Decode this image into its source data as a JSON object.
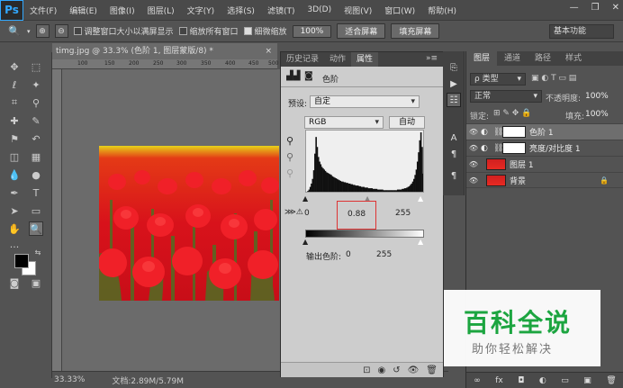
{
  "app": {
    "logo": "Ps"
  },
  "menu": [
    "文件(F)",
    "编辑(E)",
    "图像(I)",
    "图层(L)",
    "文字(Y)",
    "选择(S)",
    "滤镜(T)",
    "3D(D)",
    "视图(V)",
    "窗口(W)",
    "帮助(H)"
  ],
  "window_controls": {
    "minimize": "—",
    "restore": "❐",
    "close": "✕"
  },
  "options": {
    "cb1": "调整窗口大小以满屏显示",
    "cb2": "缩放所有窗口",
    "cb3": "细微缩放",
    "zoom": "100%",
    "fit_screen": "适合屏幕",
    "fill_screen": "填充屏幕",
    "workspace": "基本功能"
  },
  "document": {
    "tab": "timg.jpg @ 33.3% (色阶 1, 图层蒙版/8) *",
    "close": "×",
    "zoom": "33.33%",
    "doc_info": "文档:2.89M/5.79M",
    "ruler_ticks": [
      "100",
      "150",
      "200",
      "250",
      "300",
      "350",
      "400",
      "450",
      "500"
    ]
  },
  "properties": {
    "tabs": [
      "历史记录",
      "动作",
      "属性"
    ],
    "active_tab": "属性",
    "title": "色阶",
    "preset_label": "预设:",
    "preset_value": "自定",
    "channel": "RGB",
    "auto": "自动",
    "input_black": "0",
    "input_mid": "0.88",
    "input_white": "255",
    "output_label": "输出色阶:",
    "output_black": "0",
    "output_white": "255",
    "histogram": [
      2,
      4,
      6,
      10,
      15,
      22,
      35,
      60,
      85,
      70,
      55,
      48,
      44,
      40,
      38,
      36,
      34,
      32,
      31,
      30,
      29,
      28,
      26,
      25,
      24,
      23,
      22,
      21,
      20,
      19,
      18,
      18,
      17,
      17,
      16,
      16,
      15,
      15,
      14,
      14,
      13,
      13,
      12,
      12,
      12,
      11,
      11,
      10,
      10,
      10,
      9,
      9,
      9,
      8,
      8,
      8,
      8,
      7,
      7,
      7,
      7,
      6,
      6,
      6,
      6,
      6,
      5,
      5,
      5,
      5,
      5,
      5,
      5,
      5,
      5,
      5,
      5,
      5,
      6,
      6,
      6,
      6,
      7,
      7,
      8,
      8,
      9,
      10,
      11,
      13,
      15,
      18,
      22,
      28,
      36,
      48,
      62,
      80,
      92,
      70,
      30,
      8
    ]
  },
  "layers": {
    "tabs": [
      "图层",
      "通道",
      "路径",
      "样式"
    ],
    "filter": "ρ 类型",
    "blend": "正常",
    "opacity_label": "不透明度:",
    "opacity": "100%",
    "lock_label": "锁定:",
    "fill_label": "填充:",
    "fill": "100%",
    "items": [
      {
        "name": "色阶 1",
        "selected": true,
        "kind": "adjust"
      },
      {
        "name": "亮度/对比度 1",
        "selected": false,
        "kind": "adjust"
      },
      {
        "name": "图层 1",
        "selected": false,
        "kind": "image"
      },
      {
        "name": "背景",
        "selected": false,
        "kind": "image",
        "lock": "🔒"
      }
    ],
    "footer": [
      "∞",
      "fx",
      "◘",
      "◐",
      "▭",
      "▣",
      "🗑"
    ]
  },
  "watermark": {
    "title": "百科全说",
    "subtitle": "助你轻松解决"
  },
  "colors": {
    "accent": "#31a8ff",
    "selected_row": "#6e6e6e",
    "watermark_green": "#1ca540",
    "highlight_box": "#dd3333"
  }
}
